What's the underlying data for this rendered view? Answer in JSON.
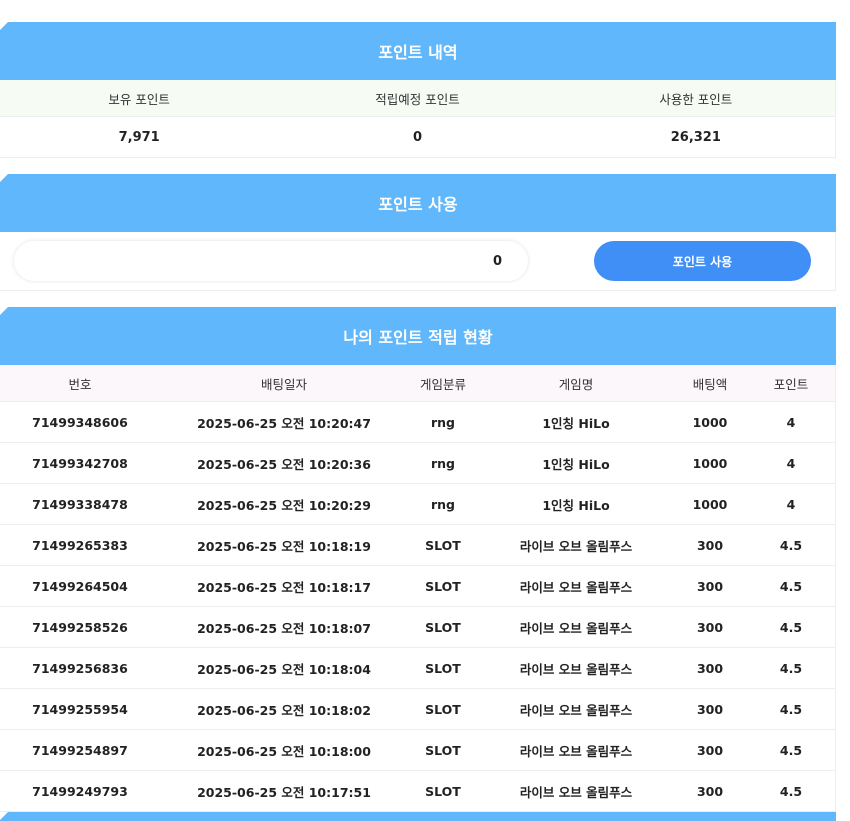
{
  "points_history": {
    "title": "포인트 내역",
    "headers": [
      "보유 포인트",
      "적립예정 포인트",
      "사용한 포인트"
    ],
    "values": [
      "7,971",
      "0",
      "26,321"
    ]
  },
  "points_use": {
    "title": "포인트 사용",
    "input_value": "0",
    "button_label": "포인트 사용"
  },
  "accrual": {
    "title": "나의 포인트 적립 현황",
    "columns": [
      "번호",
      "배팅일자",
      "게임분류",
      "게임명",
      "배팅액",
      "포인트"
    ],
    "rows": [
      [
        "71499348606",
        "2025-06-25 오전 10:20:47",
        "rng",
        "1인칭 HiLo",
        "1000",
        "4"
      ],
      [
        "71499342708",
        "2025-06-25 오전 10:20:36",
        "rng",
        "1인칭 HiLo",
        "1000",
        "4"
      ],
      [
        "71499338478",
        "2025-06-25 오전 10:20:29",
        "rng",
        "1인칭 HiLo",
        "1000",
        "4"
      ],
      [
        "71499265383",
        "2025-06-25 오전 10:18:19",
        "SLOT",
        "라이브 오브 올림푸스",
        "300",
        "4.5"
      ],
      [
        "71499264504",
        "2025-06-25 오전 10:18:17",
        "SLOT",
        "라이브 오브 올림푸스",
        "300",
        "4.5"
      ],
      [
        "71499258526",
        "2025-06-25 오전 10:18:07",
        "SLOT",
        "라이브 오브 올림푸스",
        "300",
        "4.5"
      ],
      [
        "71499256836",
        "2025-06-25 오전 10:18:04",
        "SLOT",
        "라이브 오브 올림푸스",
        "300",
        "4.5"
      ],
      [
        "71499255954",
        "2025-06-25 오전 10:18:02",
        "SLOT",
        "라이브 오브 올림푸스",
        "300",
        "4.5"
      ],
      [
        "71499254897",
        "2025-06-25 오전 10:18:00",
        "SLOT",
        "라이브 오브 올림푸스",
        "300",
        "4.5"
      ],
      [
        "71499249793",
        "2025-06-25 오전 10:17:51",
        "SLOT",
        "라이브 오브 올림푸스",
        "300",
        "4.5"
      ]
    ]
  },
  "colors": {
    "header_blue": "#60b7fb",
    "button_blue": "#3f8ff6",
    "summary_head_bg": "#f6fbf4",
    "table_head_bg": "#fbf7fb"
  }
}
